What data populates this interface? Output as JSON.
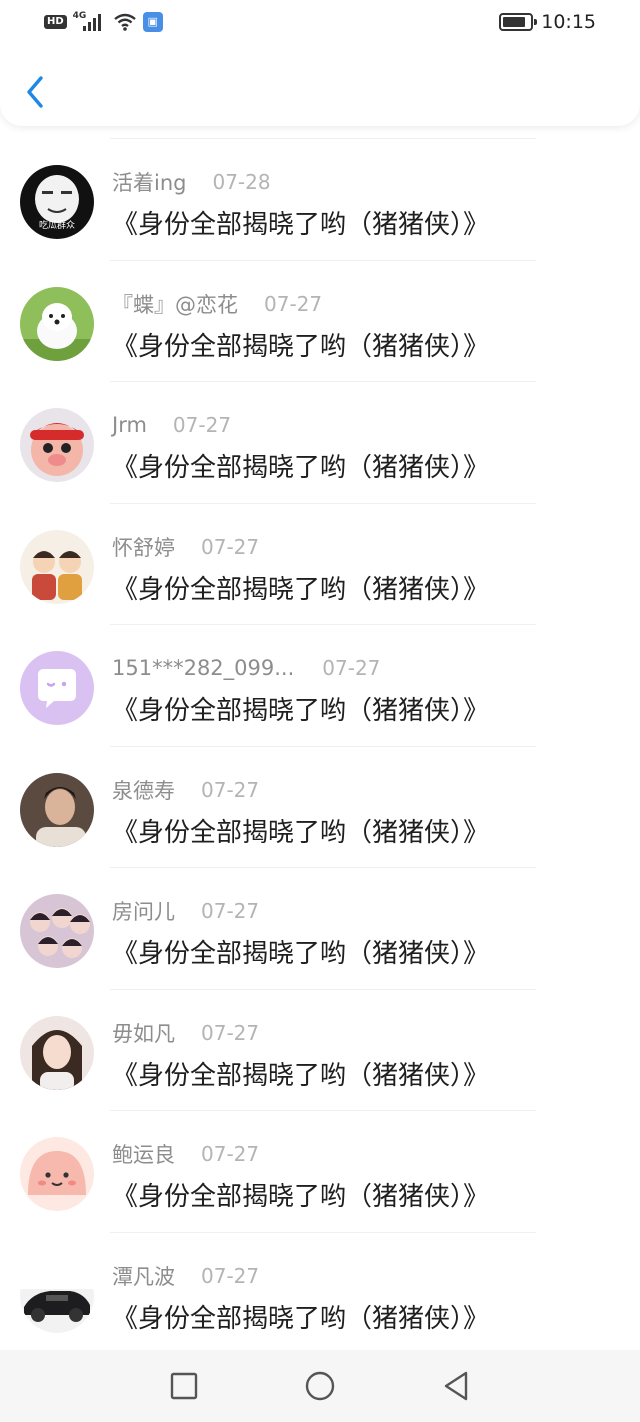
{
  "status_bar": {
    "hd": "HD",
    "network": "4G",
    "time": "10:15",
    "icons": [
      "hd-icon",
      "signal-4g-icon",
      "wifi-icon",
      "app-notification-icon",
      "battery-icon"
    ]
  },
  "header": {
    "back_icon": "chevron-left-icon",
    "accent": "#1e88e5"
  },
  "list": {
    "items": [
      {
        "username": "活着ing",
        "date": "07-28",
        "message": "《身份全部揭晓了哟（猪猪侠）》",
        "avatar_text": "吃瓜群众"
      },
      {
        "username": "『蝶』@恋花",
        "date": "07-27",
        "message": "《身份全部揭晓了哟（猪猪侠）》"
      },
      {
        "username": "Jrm",
        "date": "07-27",
        "message": "《身份全部揭晓了哟（猪猪侠）》"
      },
      {
        "username": "怀舒婷",
        "date": "07-27",
        "message": "《身份全部揭晓了哟（猪猪侠）》"
      },
      {
        "username": "151***282_099...",
        "date": "07-27",
        "message": "《身份全部揭晓了哟（猪猪侠）》"
      },
      {
        "username": "泉德寿",
        "date": "07-27",
        "message": "《身份全部揭晓了哟（猪猪侠）》"
      },
      {
        "username": "房问儿",
        "date": "07-27",
        "message": "《身份全部揭晓了哟（猪猪侠）》"
      },
      {
        "username": "毋如凡",
        "date": "07-27",
        "message": "《身份全部揭晓了哟（猪猪侠）》"
      },
      {
        "username": "鲍运良",
        "date": "07-27",
        "message": "《身份全部揭晓了哟（猪猪侠）》"
      },
      {
        "username": "潭凡波",
        "date": "07-27",
        "message": "《身份全部揭晓了哟（猪猪侠）》"
      }
    ]
  },
  "nav_bar": {
    "icons": [
      "recent-apps-square-icon",
      "home-circle-icon",
      "back-triangle-icon"
    ]
  }
}
